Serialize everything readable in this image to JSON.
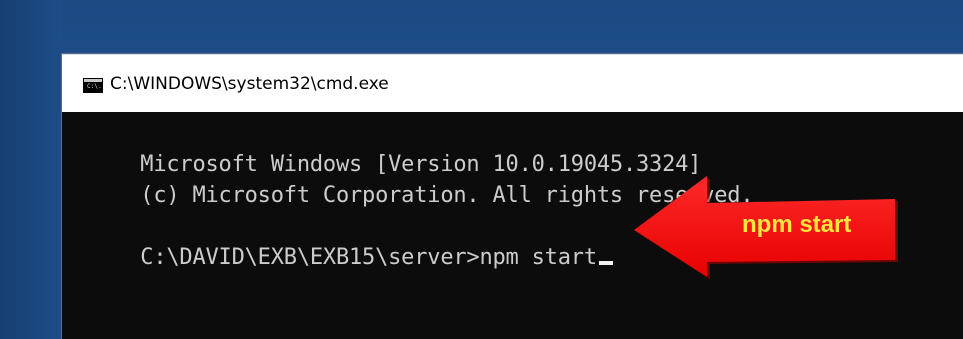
{
  "window": {
    "title": "C:\\WINDOWS\\system32\\cmd.exe",
    "icon_name": "cmd-icon",
    "icon_text": "C:\\."
  },
  "terminal": {
    "lines": [
      "Microsoft Windows [Version 10.0.19045.3324]",
      "(c) Microsoft Corporation. All rights reserved.",
      "C:\\DAVID\\EXB\\EXB15\\server>npm start"
    ],
    "colors": {
      "background": "#0c0c0c",
      "text": "#cccccc",
      "cursor": "#f2f2f2"
    }
  },
  "annotation": {
    "label": "npm start",
    "icon_name": "left-arrow-icon",
    "fill": "#ff1717",
    "text_color": "#ffe53d"
  },
  "desktop": {
    "background": "#1f4d86"
  }
}
